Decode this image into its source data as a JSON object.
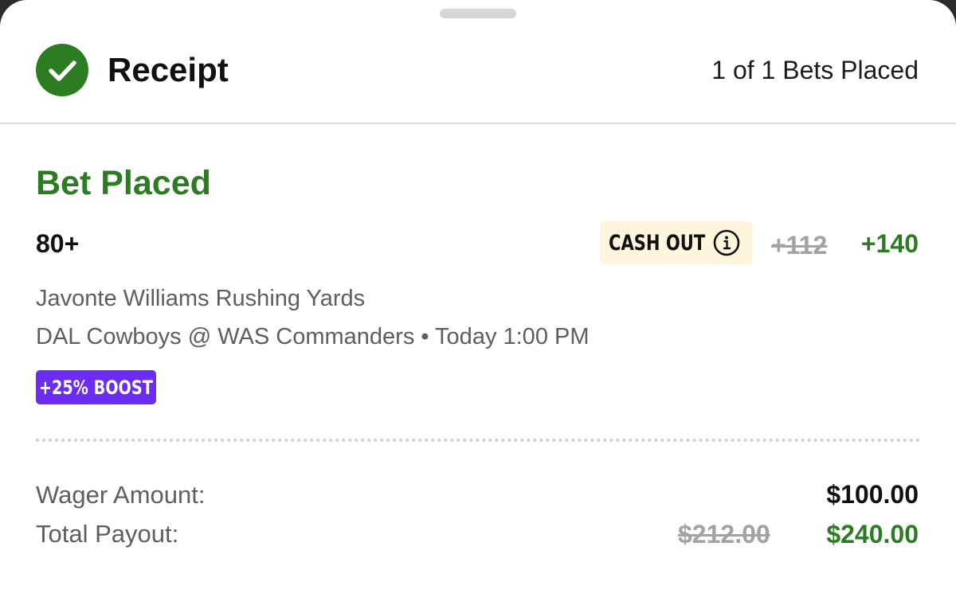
{
  "header": {
    "title": "Receipt",
    "bets_placed": "1 of 1 Bets Placed"
  },
  "bet": {
    "status": "Bet Placed",
    "selection": "80+",
    "cash_out_label": "CASH OUT",
    "original_odds": "+112",
    "boosted_odds": "+140",
    "market": "Javonte Williams Rushing Yards",
    "event": "DAL Cowboys @ WAS Commanders • Today 1:00 PM",
    "boost_badge": "+25% BOOST"
  },
  "summary": {
    "wager_label": "Wager Amount:",
    "wager_value": "$100.00",
    "payout_label": "Total Payout:",
    "original_payout": "$212.00",
    "boosted_payout": "$240.00"
  },
  "icons": {
    "status": "check-circle-icon",
    "info": "info-icon"
  },
  "colors": {
    "success_green": "#2c7d22",
    "boost_purple": "#6d2cf3",
    "cash_out_bg": "#fdf6dc",
    "strikethrough_gray": "#a3a3a3"
  }
}
